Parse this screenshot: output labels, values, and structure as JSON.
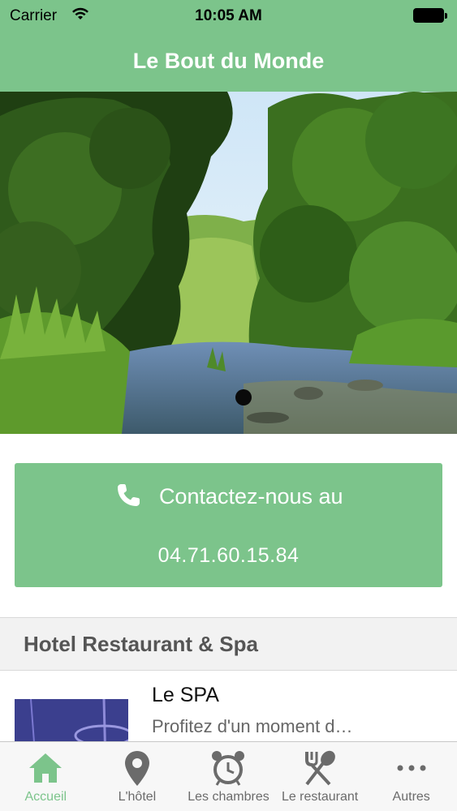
{
  "status_bar": {
    "carrier": "Carrier",
    "time": "10:05 AM",
    "wifi_icon": "wifi-icon",
    "battery_icon": "battery-icon"
  },
  "nav": {
    "title": "Le Bout du Monde"
  },
  "hero": {
    "image": "river-forest-photo",
    "pager_dots": 1
  },
  "contact": {
    "label": "Contactez-nous au",
    "number": "04.71.60.15.84",
    "icon": "phone-icon"
  },
  "section": {
    "title": "Hotel Restaurant & Spa"
  },
  "list": [
    {
      "title": "Le SPA",
      "subtitle": "Profitez d'un moment d…"
    }
  ],
  "tabs": [
    {
      "label": "Accueil",
      "icon": "home-icon",
      "active": true
    },
    {
      "label": "L'hôtel",
      "icon": "map-pin-icon",
      "active": false
    },
    {
      "label": "Les chambres",
      "icon": "alarm-clock-icon",
      "active": false
    },
    {
      "label": "Le restaurant",
      "icon": "fork-spoon-icon",
      "active": false
    },
    {
      "label": "Autres",
      "icon": "more-icon",
      "active": false
    }
  ],
  "colors": {
    "accent": "#7cc48b",
    "tab_inactive": "#6b6b6b",
    "section_bg": "#f2f2f2"
  }
}
